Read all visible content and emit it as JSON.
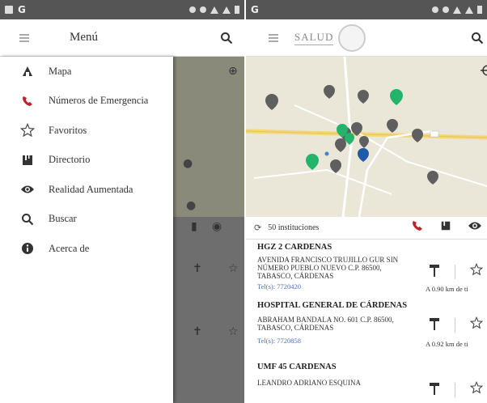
{
  "left_screen": {
    "toolbar": {
      "title": "Menú"
    },
    "drawer": {
      "items": [
        {
          "label": "Mapa",
          "icon": "map-pin-icon"
        },
        {
          "label": "Números de Emergencia",
          "icon": "phone-icon"
        },
        {
          "label": "Favoritos",
          "icon": "star-icon"
        },
        {
          "label": "Directorio",
          "icon": "directory-icon"
        },
        {
          "label": "Realidad Aumentada",
          "icon": "eye-icon"
        },
        {
          "label": "Buscar",
          "icon": "search-icon"
        },
        {
          "label": "Acerca de",
          "icon": "info-icon"
        }
      ]
    }
  },
  "right_screen": {
    "toolbar": {
      "logo_text": "SALUD"
    },
    "list": {
      "count_label": "50 instituciones",
      "results": [
        {
          "name": "HGZ 2 CARDENAS",
          "address": "AVENIDA FRANCISCO TRUJILLO GUR SIN NÚMERO PUEBLO NUEVO C.P. 86500, TABASCO, CÁRDENAS",
          "tel": "Tel(s): 7720420",
          "distance": "A 0.90 km de ti"
        },
        {
          "name": "HOSPITAL GENERAL DE CÁRDENAS",
          "address": "ABRAHAM BANDALA NO. 601 C.P. 86500, TABASCO, CÁRDENAS",
          "tel": "Tel(s): 7720858",
          "distance": "A 0.92 km de ti"
        },
        {
          "name": "UMF 45 CARDENAS",
          "address": "LEANDRO ADRIANO ESQUINA",
          "tel": "",
          "distance": ""
        }
      ]
    }
  },
  "colors": {
    "accent_red": "#c0202a",
    "pin_gray": "#5f5f5f",
    "pin_green": "#23b36a",
    "pin_blue": "#1f5aa8",
    "link_blue": "#4a6fb5"
  }
}
